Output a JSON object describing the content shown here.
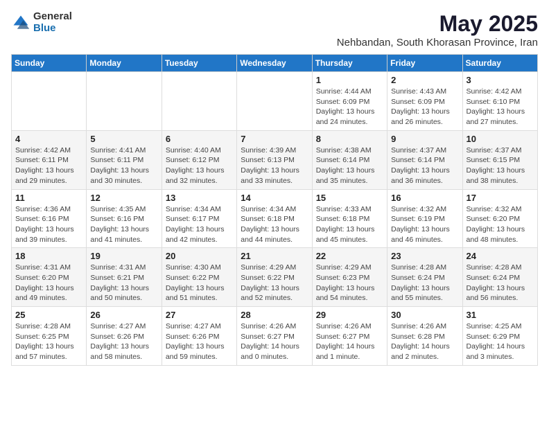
{
  "logo": {
    "general": "General",
    "blue": "Blue"
  },
  "title": "May 2025",
  "subtitle": "Nehbandan, South Khorasan Province, Iran",
  "weekdays": [
    "Sunday",
    "Monday",
    "Tuesday",
    "Wednesday",
    "Thursday",
    "Friday",
    "Saturday"
  ],
  "weeks": [
    [
      {
        "day": "",
        "info": ""
      },
      {
        "day": "",
        "info": ""
      },
      {
        "day": "",
        "info": ""
      },
      {
        "day": "",
        "info": ""
      },
      {
        "day": "1",
        "info": "Sunrise: 4:44 AM\nSunset: 6:09 PM\nDaylight: 13 hours\nand 24 minutes."
      },
      {
        "day": "2",
        "info": "Sunrise: 4:43 AM\nSunset: 6:09 PM\nDaylight: 13 hours\nand 26 minutes."
      },
      {
        "day": "3",
        "info": "Sunrise: 4:42 AM\nSunset: 6:10 PM\nDaylight: 13 hours\nand 27 minutes."
      }
    ],
    [
      {
        "day": "4",
        "info": "Sunrise: 4:42 AM\nSunset: 6:11 PM\nDaylight: 13 hours\nand 29 minutes."
      },
      {
        "day": "5",
        "info": "Sunrise: 4:41 AM\nSunset: 6:11 PM\nDaylight: 13 hours\nand 30 minutes."
      },
      {
        "day": "6",
        "info": "Sunrise: 4:40 AM\nSunset: 6:12 PM\nDaylight: 13 hours\nand 32 minutes."
      },
      {
        "day": "7",
        "info": "Sunrise: 4:39 AM\nSunset: 6:13 PM\nDaylight: 13 hours\nand 33 minutes."
      },
      {
        "day": "8",
        "info": "Sunrise: 4:38 AM\nSunset: 6:14 PM\nDaylight: 13 hours\nand 35 minutes."
      },
      {
        "day": "9",
        "info": "Sunrise: 4:37 AM\nSunset: 6:14 PM\nDaylight: 13 hours\nand 36 minutes."
      },
      {
        "day": "10",
        "info": "Sunrise: 4:37 AM\nSunset: 6:15 PM\nDaylight: 13 hours\nand 38 minutes."
      }
    ],
    [
      {
        "day": "11",
        "info": "Sunrise: 4:36 AM\nSunset: 6:16 PM\nDaylight: 13 hours\nand 39 minutes."
      },
      {
        "day": "12",
        "info": "Sunrise: 4:35 AM\nSunset: 6:16 PM\nDaylight: 13 hours\nand 41 minutes."
      },
      {
        "day": "13",
        "info": "Sunrise: 4:34 AM\nSunset: 6:17 PM\nDaylight: 13 hours\nand 42 minutes."
      },
      {
        "day": "14",
        "info": "Sunrise: 4:34 AM\nSunset: 6:18 PM\nDaylight: 13 hours\nand 44 minutes."
      },
      {
        "day": "15",
        "info": "Sunrise: 4:33 AM\nSunset: 6:18 PM\nDaylight: 13 hours\nand 45 minutes."
      },
      {
        "day": "16",
        "info": "Sunrise: 4:32 AM\nSunset: 6:19 PM\nDaylight: 13 hours\nand 46 minutes."
      },
      {
        "day": "17",
        "info": "Sunrise: 4:32 AM\nSunset: 6:20 PM\nDaylight: 13 hours\nand 48 minutes."
      }
    ],
    [
      {
        "day": "18",
        "info": "Sunrise: 4:31 AM\nSunset: 6:20 PM\nDaylight: 13 hours\nand 49 minutes."
      },
      {
        "day": "19",
        "info": "Sunrise: 4:31 AM\nSunset: 6:21 PM\nDaylight: 13 hours\nand 50 minutes."
      },
      {
        "day": "20",
        "info": "Sunrise: 4:30 AM\nSunset: 6:22 PM\nDaylight: 13 hours\nand 51 minutes."
      },
      {
        "day": "21",
        "info": "Sunrise: 4:29 AM\nSunset: 6:22 PM\nDaylight: 13 hours\nand 52 minutes."
      },
      {
        "day": "22",
        "info": "Sunrise: 4:29 AM\nSunset: 6:23 PM\nDaylight: 13 hours\nand 54 minutes."
      },
      {
        "day": "23",
        "info": "Sunrise: 4:28 AM\nSunset: 6:24 PM\nDaylight: 13 hours\nand 55 minutes."
      },
      {
        "day": "24",
        "info": "Sunrise: 4:28 AM\nSunset: 6:24 PM\nDaylight: 13 hours\nand 56 minutes."
      }
    ],
    [
      {
        "day": "25",
        "info": "Sunrise: 4:28 AM\nSunset: 6:25 PM\nDaylight: 13 hours\nand 57 minutes."
      },
      {
        "day": "26",
        "info": "Sunrise: 4:27 AM\nSunset: 6:26 PM\nDaylight: 13 hours\nand 58 minutes."
      },
      {
        "day": "27",
        "info": "Sunrise: 4:27 AM\nSunset: 6:26 PM\nDaylight: 13 hours\nand 59 minutes."
      },
      {
        "day": "28",
        "info": "Sunrise: 4:26 AM\nSunset: 6:27 PM\nDaylight: 14 hours\nand 0 minutes."
      },
      {
        "day": "29",
        "info": "Sunrise: 4:26 AM\nSunset: 6:27 PM\nDaylight: 14 hours\nand 1 minute."
      },
      {
        "day": "30",
        "info": "Sunrise: 4:26 AM\nSunset: 6:28 PM\nDaylight: 14 hours\nand 2 minutes."
      },
      {
        "day": "31",
        "info": "Sunrise: 4:25 AM\nSunset: 6:29 PM\nDaylight: 14 hours\nand 3 minutes."
      }
    ]
  ]
}
